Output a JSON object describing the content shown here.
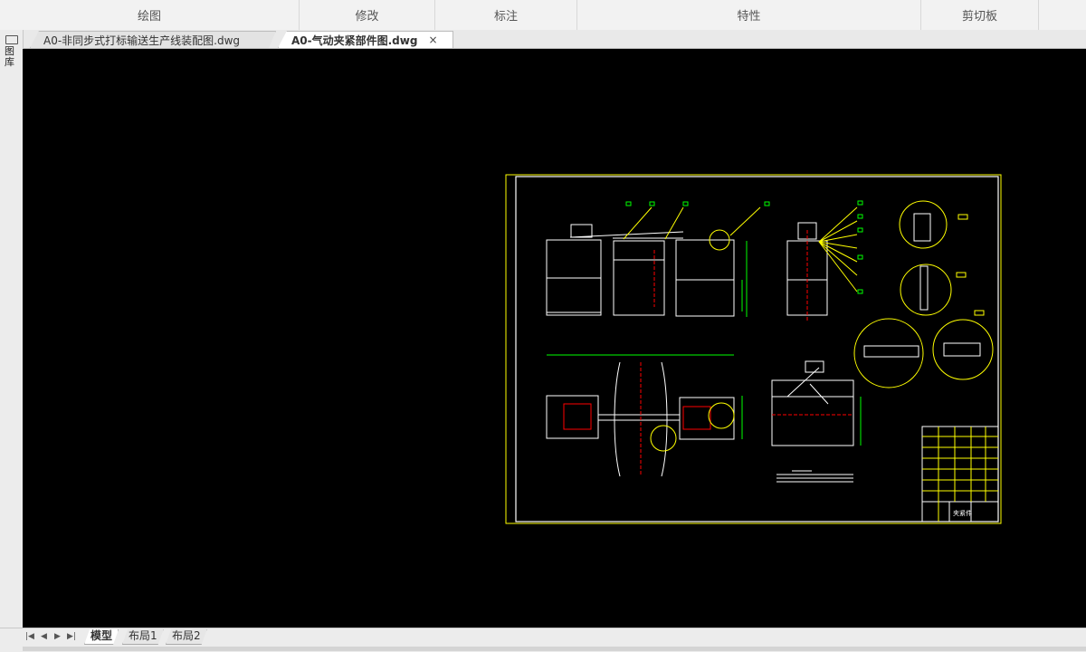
{
  "ribbon": {
    "groups": [
      {
        "label": "绘图"
      },
      {
        "label": "修改"
      },
      {
        "label": "标注"
      },
      {
        "label": "特性"
      },
      {
        "label": "剪切板"
      }
    ]
  },
  "tabs": {
    "doc1": "A0-非同步式打标输送生产线装配图.dwg",
    "doc2": "A0-气动夹紧部件图.dwg",
    "close": "×"
  },
  "leftbar": {
    "command": "图库"
  },
  "layout_tabs": {
    "nav": [
      "|◀",
      "◀",
      "▶",
      "▶|"
    ],
    "model": "模型",
    "layout1": "布局1",
    "layout2": "布局2"
  },
  "drawing": {
    "title_cell": "夹紧件"
  },
  "colors": {
    "canvas": "#000000",
    "border": "#ffff00",
    "frame": "#ffffff",
    "dim": "#00ff00",
    "center": "#ff0000",
    "detail": "#ffff00"
  }
}
